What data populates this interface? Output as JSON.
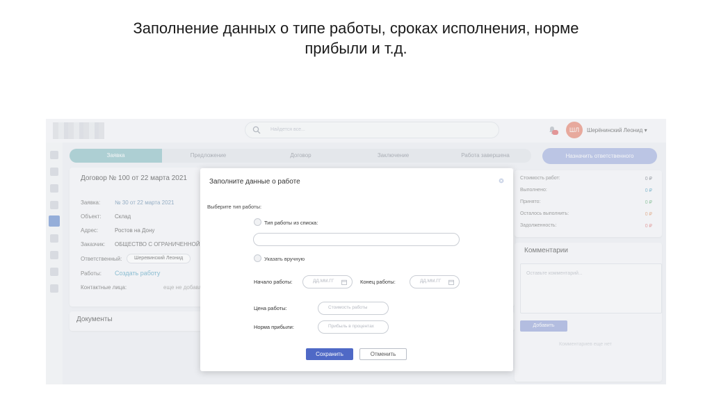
{
  "slide": {
    "title_line1": "Заполнение данных о типе работы, сроках исполнения, норме",
    "title_line2": "прибыли и т.д."
  },
  "header": {
    "search_placeholder": "Найдется все...",
    "avatar_initials": "ШЛ",
    "user_name": "Шерёнинский Леонид ▾",
    "icons": [
      "search-icon",
      "bell-icon"
    ]
  },
  "steps": [
    "Заявка",
    "Предложение",
    "Договор",
    "Заключение",
    "Работа завершена"
  ],
  "assign_button": "Назначить ответственного",
  "contract": {
    "title": "Договор № 100 от 22 марта 2021",
    "fields": [
      {
        "label": "Заявка:",
        "value": "№ 30 от 22 марта 2021"
      },
      {
        "label": "Объект:",
        "value": "Склад"
      },
      {
        "label": "Адрес:",
        "value": "Ростов на Дону"
      },
      {
        "label": "Заказчик:",
        "value": "ОБЩЕСТВО С ОГРАНИЧЕННОЙ О"
      },
      {
        "label": "Ответственный:",
        "value": "Шеревинский Леонид"
      },
      {
        "label": "Работы:",
        "value": "Создать работу"
      },
      {
        "label": "Контактные лица:",
        "value": "еще не добавл"
      }
    ]
  },
  "documents_title": "Документы",
  "stats": [
    {
      "label": "Стоимость работ:",
      "value": "0 ₽"
    },
    {
      "label": "Выполнено:",
      "value": "0 ₽"
    },
    {
      "label": "Принято:",
      "value": "0 ₽"
    },
    {
      "label": "Осталось выполнить:",
      "value": "0 ₽"
    },
    {
      "label": "Задолженность:",
      "value": "0 ₽"
    }
  ],
  "comments": {
    "title": "Комментарии",
    "placeholder": "Оставьте комментарий...",
    "add_button": "Добавить",
    "empty": "Комментариев еще нет"
  },
  "modal": {
    "title": "Заполните данные о работе",
    "select_type_label": "Выберите тип работы:",
    "option_list": "Тип работы из списка:",
    "option_manual": "Указать вручную",
    "start_label": "Начало работы:",
    "start_placeholder": "ДД.ММ.ГГ",
    "end_label": "Конец работы:",
    "end_placeholder": "ДД.ММ.ГГ",
    "price_label": "Цена работы:",
    "price_placeholder": "Стоимость работы",
    "profit_label": "Норма прибыли:",
    "profit_placeholder": "Прибыль в процентах",
    "save_button": "Сохранить",
    "cancel_button": "Отменить"
  }
}
